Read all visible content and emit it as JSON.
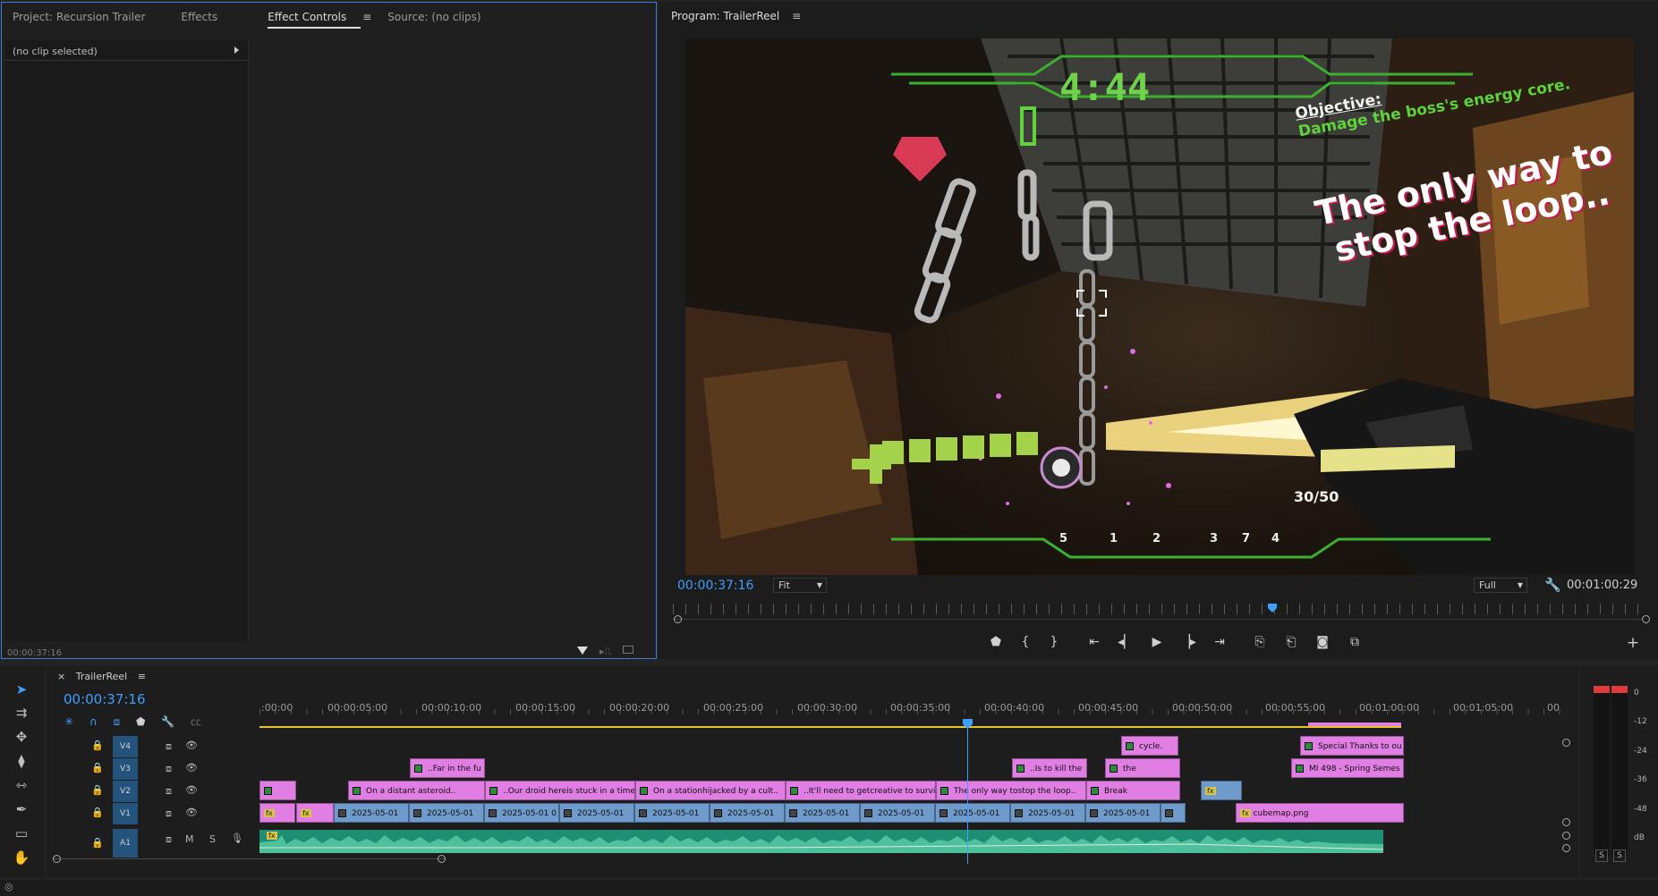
{
  "effect_panel": {
    "tabs": [
      {
        "label": "Project: Recursion Trailer"
      },
      {
        "label": "Effects"
      },
      {
        "label": "Effect Controls"
      },
      {
        "label": "Source: (no clips)"
      }
    ],
    "menu_glyph": "≡",
    "no_clip_text": "(no clip selected)",
    "timecode": "00:00:37:16"
  },
  "program": {
    "title": "Program: TrailerReel",
    "menu_glyph": "≡",
    "timecode": "00:00:37:16",
    "zoom": "Fit",
    "resolution": "Full",
    "duration": "00:01:00:29",
    "hud": {
      "timer": "4:44",
      "objective_label": "Objective:",
      "objective_text": "Damage the boss's energy core.",
      "caption_line1": "The only way to",
      "caption_line2": "stop the loop..",
      "ammo": "30/50",
      "slots": [
        "5",
        "1",
        "2",
        "3",
        "7",
        "4"
      ]
    },
    "add_glyph": "+"
  },
  "timeline": {
    "close_glyph": "×",
    "sequence_name": "TrailerReel",
    "menu_glyph": "≡",
    "timecode": "00:00:37:16",
    "ruler": [
      ":00:00",
      "00:00:05:00",
      "00:00:10:00",
      "00:00:15:00",
      "00:00:20:00",
      "00:00:25:00",
      "00:00:30:00",
      "00:00:35:00",
      "00:00:40:00",
      "00:00:45:00",
      "00:00:50:00",
      "00:00:55:00",
      "00:01:00:00",
      "00:01:05:00",
      "00"
    ],
    "tracks": {
      "v4": "V4",
      "v3": "V3",
      "v2": "V2",
      "v1": "V1",
      "a1": "A1",
      "m": "M",
      "s": "S"
    },
    "clips": {
      "v4": [
        "cycle.",
        "Special Thanks to ou"
      ],
      "v3": [
        "..Far in the fu",
        "..Is to kill the",
        "the",
        "MI 498 - Spring Semes"
      ],
      "v2": [
        "On a distant asteroid..",
        "..Our droid hereis stuck in a time l",
        "On a stationhijacked by a cult..",
        "..It'll need to getcreative to surviv",
        "The only way tostop the loop..",
        "Break"
      ],
      "v1": [
        "2025-05-01",
        "2025-05-01",
        "2025-05-01 0",
        "2025-05-01",
        "2025-05-01",
        "2025-05-01",
        "2025-05-01",
        "2025-05-01",
        "2025-05-01",
        "2025-05-01",
        "2025-05-01",
        "cubemap.png"
      ],
      "fx_label": "fx"
    }
  },
  "meter": {
    "labels": [
      "0",
      "-12",
      "-24",
      "-36",
      "-48",
      "dB"
    ],
    "solo": [
      "S",
      "S"
    ]
  },
  "colors": {
    "accent": "#3f9fff",
    "clip_pink": "#e07ee3",
    "clip_blue": "#6f9bcc",
    "audio": "#1f8f73",
    "hud_green": "#5fd23c",
    "hud_red": "#d93a55"
  }
}
